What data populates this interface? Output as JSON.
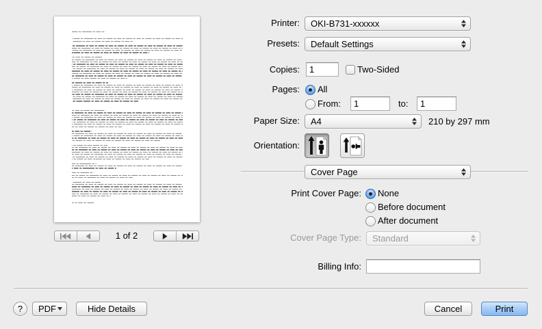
{
  "colors": {
    "window_bg": "#ececec",
    "accent": "#3d87df",
    "default_button": "#86b8f0",
    "disabled_text": "#9a9a9a"
  },
  "preview": {
    "page_indicator": "1 of 2",
    "icons": {
      "first": "first-page-icon",
      "previous": "previous-page-icon",
      "next": "next-page-icon",
      "last": "last-page-icon"
    }
  },
  "form": {
    "printer": {
      "label": "Printer:",
      "value": "OKI-B731-xxxxxx"
    },
    "presets": {
      "label": "Presets:",
      "value": "Default Settings"
    },
    "copies": {
      "label": "Copies:",
      "value": "1"
    },
    "two_sided": {
      "label": "Two-Sided",
      "checked": false
    },
    "pages": {
      "label": "Pages:",
      "all_label": "All",
      "all_selected": true,
      "from_label": "From:",
      "from_selected": false,
      "from_value": "1",
      "to_label": "to:",
      "to_value": "1"
    },
    "paper_size": {
      "label": "Paper Size:",
      "value": "A4",
      "dimensions": "210 by 297 mm"
    },
    "orientation": {
      "label": "Orientation:",
      "portrait_selected": true,
      "landscape_selected": false,
      "portrait_icon": "portrait-orientation-icon",
      "landscape_icon": "landscape-orientation-icon"
    }
  },
  "cover_page": {
    "section": "Cover Page",
    "print_label": "Print Cover Page:",
    "options": [
      {
        "label": "None",
        "selected": true
      },
      {
        "label": "Before document",
        "selected": false
      },
      {
        "label": "After document",
        "selected": false
      }
    ],
    "type_label": "Cover Page Type:",
    "type_value": "Standard",
    "type_enabled": false,
    "billing_label": "Billing Info:",
    "billing_value": ""
  },
  "footer": {
    "help_label": "?",
    "pdf_label": "PDF",
    "hide_details_label": "Hide Details",
    "cancel_label": "Cancel",
    "print_label": "Print"
  }
}
